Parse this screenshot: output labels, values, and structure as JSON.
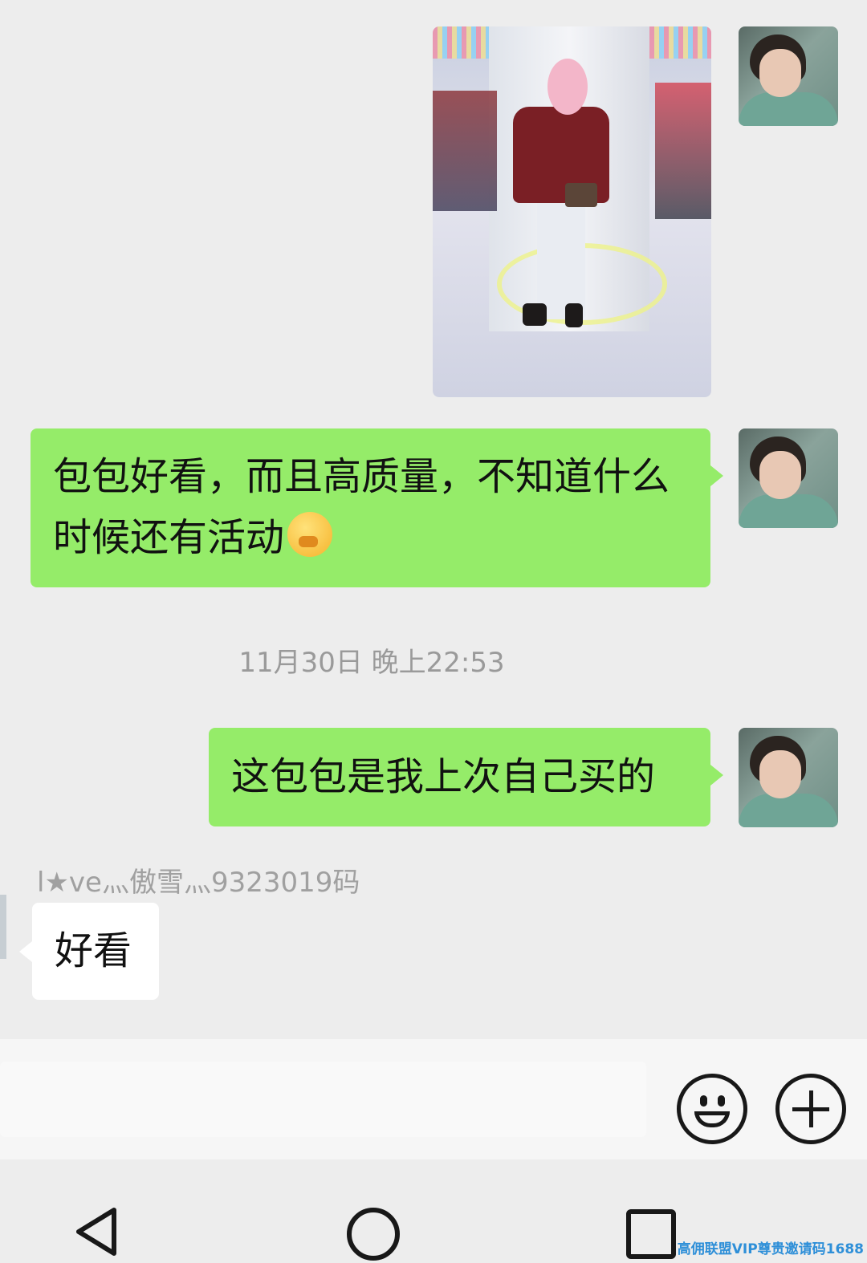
{
  "messages": [
    {
      "type": "image",
      "side": "outgoing"
    },
    {
      "type": "text",
      "side": "outgoing",
      "text": "包包好看，而且高质量，不知道什么时候还有活动",
      "emoji": "thinking-emoji"
    },
    {
      "type": "timestamp",
      "text": "11月30日 晚上22:53"
    },
    {
      "type": "text",
      "side": "outgoing",
      "text": "这包包是我上次自己买的"
    },
    {
      "type": "text",
      "side": "incoming",
      "sender": "l★ve灬傲雪灬9323019码",
      "text": "好看"
    }
  ],
  "input_bar": {
    "emoji_button_icon": "smiley-icon",
    "more_button_icon": "plus-circle-icon"
  },
  "nav": {
    "back_icon": "triangle-back-icon",
    "home_icon": "circle-home-icon",
    "recent_icon": "square-recent-icon"
  },
  "watermark": "高佣联盟VIP尊贵邀请码1688",
  "colors": {
    "chat_background": "#ededed",
    "outgoing_bubble": "#95ec69",
    "incoming_bubble": "#ffffff",
    "timestamp_text": "#9a9a9a",
    "watermark": "#2e8fd8"
  }
}
